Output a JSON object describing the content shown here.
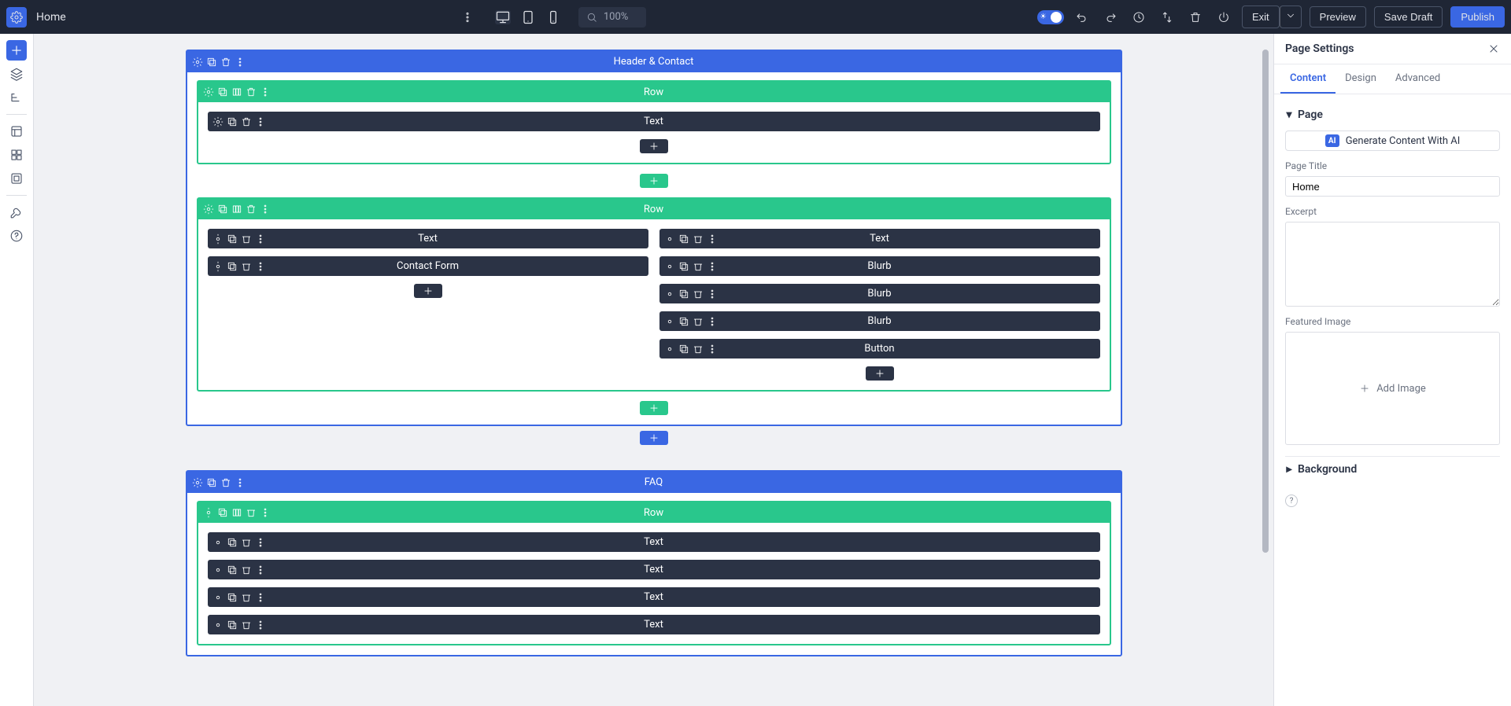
{
  "topbar": {
    "title": "Home",
    "zoom": "100%",
    "exit": "Exit",
    "preview": "Preview",
    "save_draft": "Save Draft",
    "publish": "Publish"
  },
  "leftbar": {
    "items": [
      "add",
      "layers",
      "structure",
      "theme-builder",
      "theme-options",
      "library",
      "tools",
      "help"
    ]
  },
  "sections": [
    {
      "label": "Header & Contact",
      "rows": [
        {
          "label": "Row",
          "layout": "single",
          "cols": [
            {
              "modules": [
                "Text"
              ]
            }
          ]
        },
        {
          "label": "Row",
          "layout": "two",
          "cols": [
            {
              "modules": [
                "Text",
                "Contact Form"
              ]
            },
            {
              "modules": [
                "Text",
                "Blurb",
                "Blurb",
                "Blurb",
                "Button"
              ]
            }
          ]
        }
      ]
    },
    {
      "label": "FAQ",
      "rows": [
        {
          "label": "Row",
          "layout": "single",
          "cols": [
            {
              "modules": [
                "Text",
                "Text",
                "Text",
                "Text"
              ]
            }
          ]
        }
      ]
    }
  ],
  "right": {
    "title": "Page Settings",
    "tabs": [
      "Content",
      "Design",
      "Advanced"
    ],
    "active_tab": "Content",
    "page_section": "Page",
    "ai_label": "Generate Content With AI",
    "ai_badge": "AI",
    "page_title_label": "Page Title",
    "page_title_value": "Home",
    "excerpt_label": "Excerpt",
    "excerpt_value": "",
    "featured_image_label": "Featured Image",
    "add_image": "Add Image",
    "background_section": "Background"
  }
}
